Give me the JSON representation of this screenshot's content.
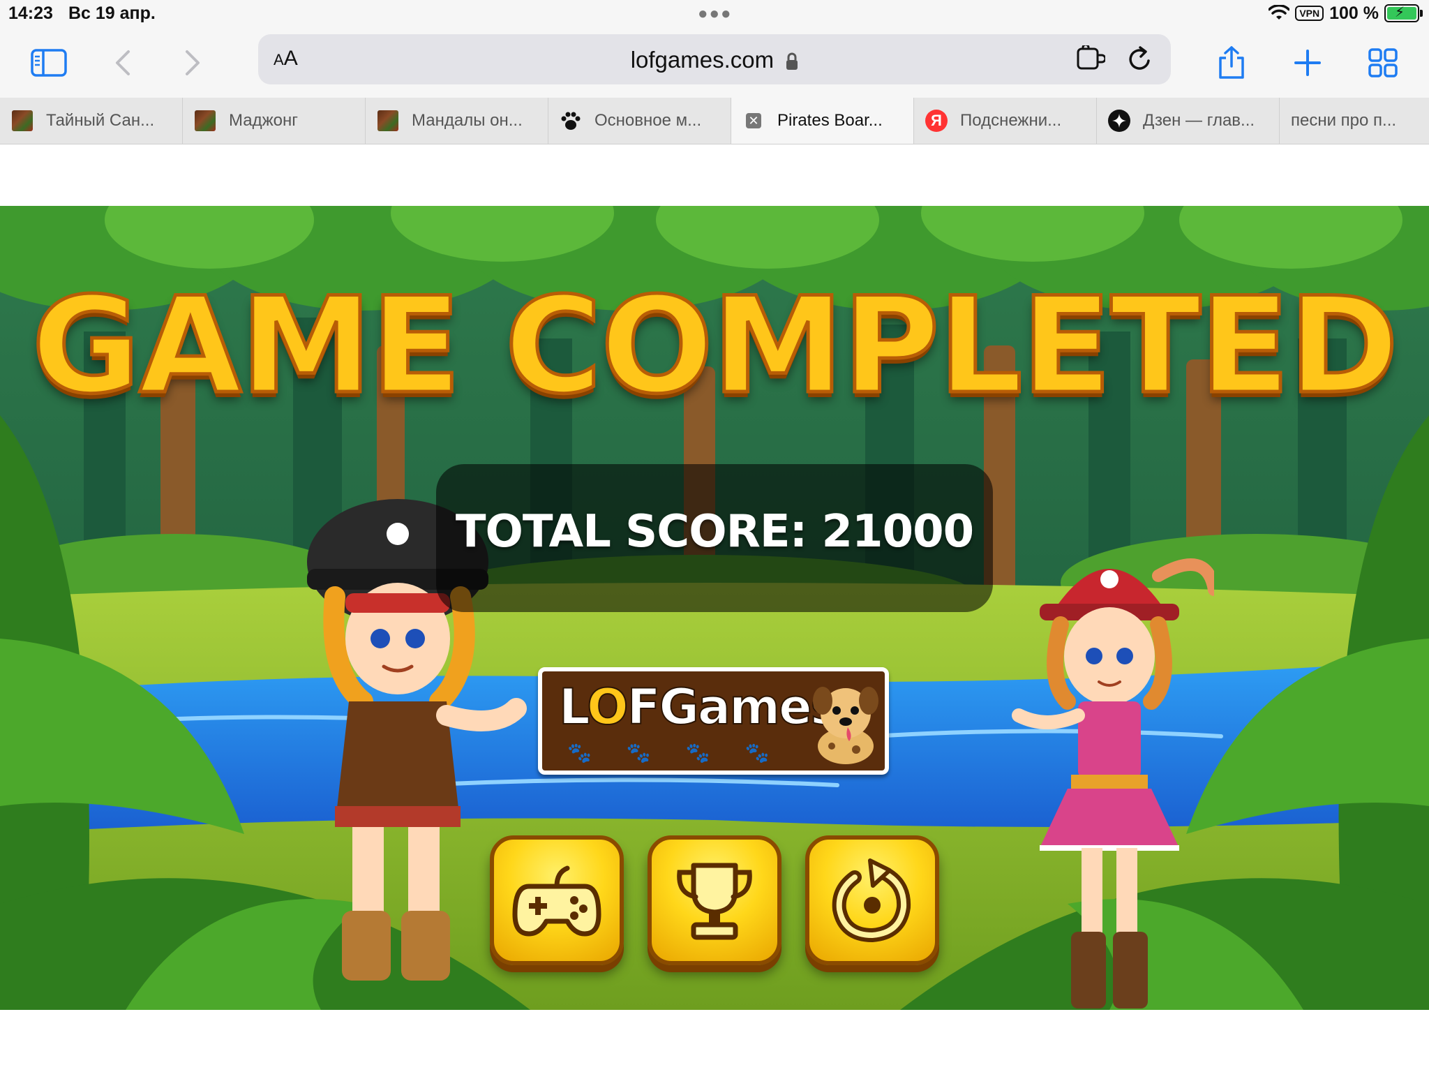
{
  "status_bar": {
    "time": "14:23",
    "date": "Вс 19 апр.",
    "vpn": "VPN",
    "battery": "100 %"
  },
  "toolbar": {
    "aa_label": "A",
    "aa_label_small": "A",
    "url": "lofgames.com"
  },
  "tabs": [
    {
      "label": "Тайный Сан...",
      "favicon": "game-thumbnail",
      "active": false
    },
    {
      "label": "Маджонг",
      "favicon": "game-thumbnail",
      "active": false
    },
    {
      "label": "Мандалы он...",
      "favicon": "game-thumbnail",
      "active": false
    },
    {
      "label": "Основное м...",
      "favicon": "paw-icon",
      "active": false
    },
    {
      "label": "Pirates Boar...",
      "favicon": "close-icon",
      "active": true
    },
    {
      "label": "Подснежни...",
      "favicon": "yandex-icon",
      "active": false
    },
    {
      "label": "Дзен — глав...",
      "favicon": "zen-icon",
      "active": false
    },
    {
      "label": "песни про п...",
      "favicon": "",
      "active": false
    }
  ],
  "game": {
    "title": "GAME COMPLETED",
    "score_text": "TOTAL SCORE: 21000",
    "logo": {
      "pre": "L",
      "o": "O",
      "post": "FGames"
    },
    "buttons": [
      {
        "name": "play-more-button",
        "icon": "gamepad-icon"
      },
      {
        "name": "leaderboard-button",
        "icon": "trophy-icon"
      },
      {
        "name": "restart-button",
        "icon": "restart-icon"
      }
    ]
  },
  "colors": {
    "accent_blue": "#1e7cf2",
    "title_gold": "#ffc61a",
    "button_yellow": "#ffd71a"
  }
}
